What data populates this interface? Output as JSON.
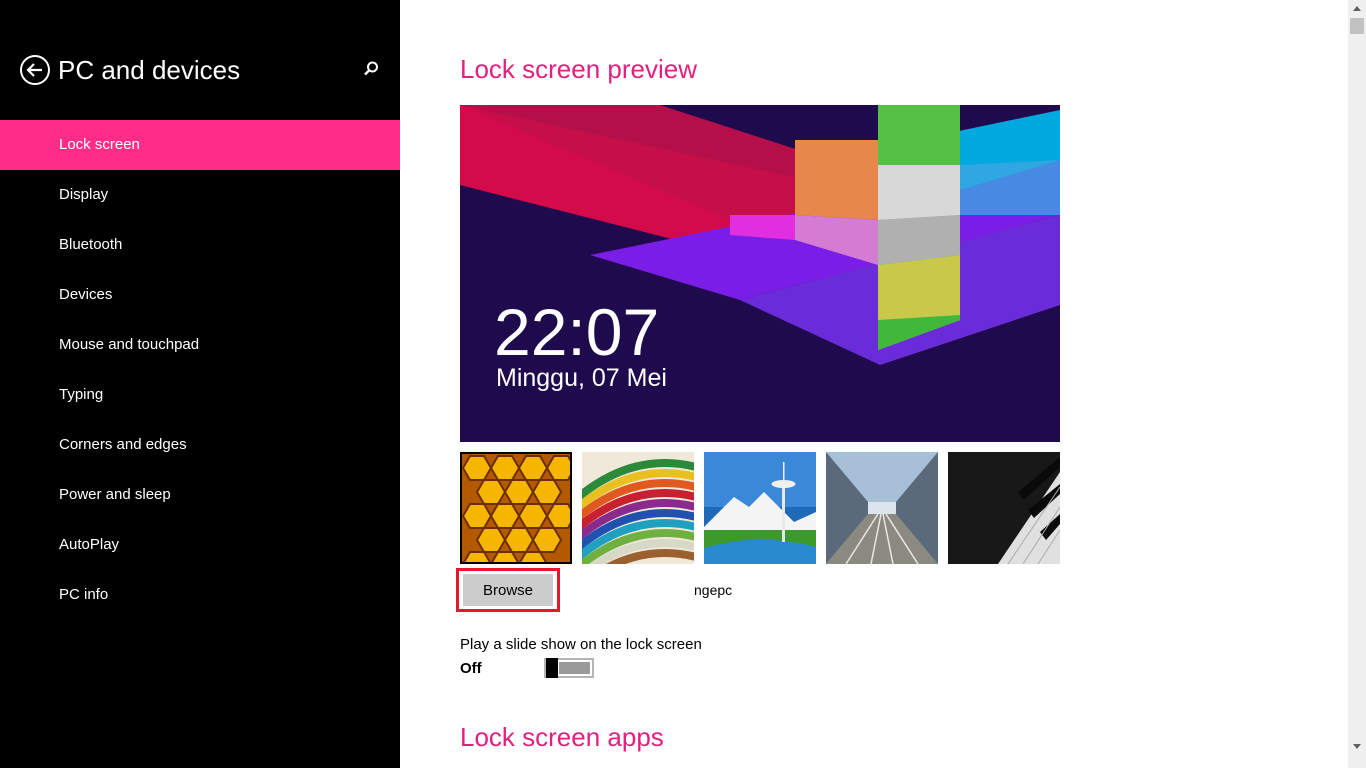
{
  "sidebar": {
    "title": "PC and devices",
    "items": [
      {
        "label": "Lock screen",
        "active": true
      },
      {
        "label": "Display"
      },
      {
        "label": "Bluetooth"
      },
      {
        "label": "Devices"
      },
      {
        "label": "Mouse and touchpad"
      },
      {
        "label": "Typing"
      },
      {
        "label": "Corners and edges"
      },
      {
        "label": "Power and sleep"
      },
      {
        "label": "AutoPlay"
      },
      {
        "label": "PC info"
      }
    ]
  },
  "main": {
    "preview_title": "Lock screen preview",
    "preview": {
      "time": "22:07",
      "date": "Minggu, 07 Mei"
    },
    "thumbnails": [
      "honeycomb",
      "colored-pencils",
      "space-needle",
      "monorail",
      "piano-keys"
    ],
    "browse_label": "Browse",
    "user_label": "ngepc",
    "slideshow_label": "Play a slide show on the lock screen",
    "slideshow_state": "Off",
    "apps_title": "Lock screen apps"
  },
  "colors": {
    "accent": "#ff2d88",
    "title": "#e3207f",
    "highlight": "#e3182d"
  }
}
